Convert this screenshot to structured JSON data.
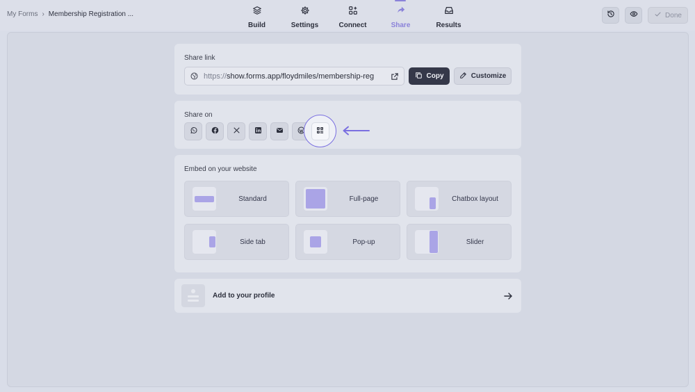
{
  "breadcrumb": {
    "root": "My Forms",
    "separator": "›",
    "current": "Membership Registration ..."
  },
  "tabs": [
    {
      "label": "Build",
      "icon": "layers-icon"
    },
    {
      "label": "Settings",
      "icon": "gear-icon"
    },
    {
      "label": "Connect",
      "icon": "grid-plus-icon"
    },
    {
      "label": "Share",
      "icon": "share-arrow-icon",
      "active": true
    },
    {
      "label": "Results",
      "icon": "inbox-icon"
    }
  ],
  "actions": {
    "history_icon": "history-icon",
    "preview_icon": "eye-icon",
    "done_label": "Done"
  },
  "share_link": {
    "title": "Share link",
    "protocol": "https://",
    "host_path": "show.forms.app/floydmiles/membership-reg",
    "copy_label": "Copy",
    "customize_label": "Customize"
  },
  "share_on": {
    "title": "Share on",
    "networks": [
      "whatsapp-icon",
      "facebook-icon",
      "x-icon",
      "linkedin-icon",
      "email-icon",
      "wordpress-icon",
      "qr-code-icon"
    ]
  },
  "embed": {
    "title": "Embed on your website",
    "options": [
      {
        "label": "Standard"
      },
      {
        "label": "Full-page"
      },
      {
        "label": "Chatbox layout"
      },
      {
        "label": "Side tab"
      },
      {
        "label": "Pop-up"
      },
      {
        "label": "Slider"
      }
    ]
  },
  "profile": {
    "label": "Add to your profile"
  },
  "colors": {
    "accent": "#8a82d9",
    "highlight": "#7a6fe0",
    "primary_button": "#353849"
  }
}
